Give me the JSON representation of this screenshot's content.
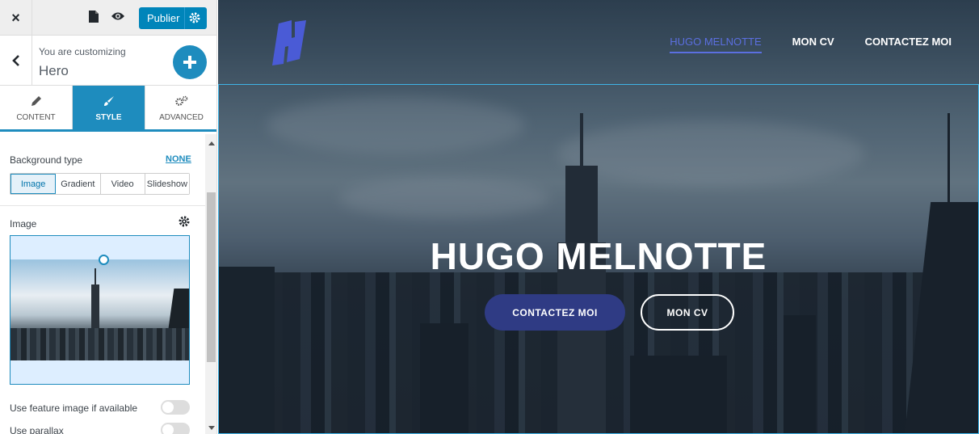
{
  "topbar": {
    "close_glyph": "×",
    "publish_label": "Publier"
  },
  "customizing": {
    "subtitle": "You are customizing",
    "section": "Hero"
  },
  "tabs": [
    {
      "label": "CONTENT",
      "icon": "pencil-icon"
    },
    {
      "label": "STYLE",
      "icon": "brush-icon",
      "active": true
    },
    {
      "label": "ADVANCED",
      "icon": "gears-icon"
    }
  ],
  "background": {
    "label": "Background type",
    "reset_link": "NONE",
    "options": [
      "Image",
      "Gradient",
      "Video",
      "Slideshow"
    ],
    "selected": "Image"
  },
  "image": {
    "label": "Image"
  },
  "toggles": {
    "feature_image": "Use feature image if available",
    "parallax": "Use parallax"
  },
  "preview": {
    "nav": [
      "HUGO MELNOTTE",
      "MON CV",
      "CONTACTEZ MOI"
    ],
    "active_nav": "HUGO MELNOTTE",
    "hero_title": "HUGO MELNOTTE",
    "primary_button": "CONTACTEZ MOI",
    "secondary_button": "MON CV"
  },
  "colors": {
    "accent": "#1e8cbe",
    "publish": "#0085ba",
    "logo": "#4a5bd6",
    "primary_button": "#2f3b84"
  }
}
